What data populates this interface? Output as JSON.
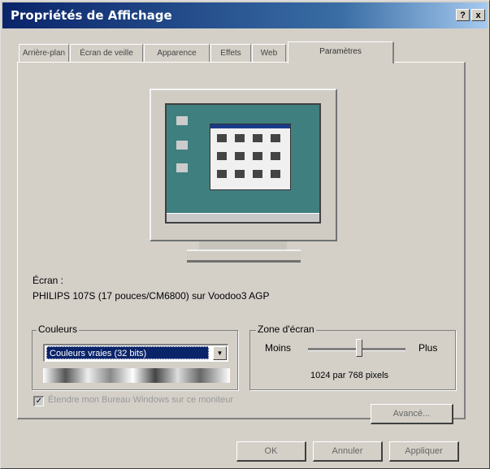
{
  "window": {
    "title": "Propriétés de Affichage",
    "help_btn": "?",
    "close_btn": "x"
  },
  "tabs": [
    {
      "label": "Arrière-plan"
    },
    {
      "label": "Écran de veille"
    },
    {
      "label": "Apparence"
    },
    {
      "label": "Effets"
    },
    {
      "label": "Web"
    },
    {
      "label": "Paramètres"
    }
  ],
  "active_tab": "Paramètres",
  "display": {
    "label": "Écran :",
    "device": "PHILIPS 107S (17 pouces/CM6800) sur Voodoo3 AGP"
  },
  "colors_group": {
    "legend": "Couleurs",
    "selected": "Couleurs vraies (32 bits)",
    "arrow": "▼"
  },
  "screen_area_group": {
    "legend": "Zone d'écran",
    "less_label": "Moins",
    "more_label": "Plus",
    "resolution": "1024 par 768 pixels",
    "slider_level": 0.5
  },
  "extend_checkbox": {
    "label": "Étendre mon Bureau Windows sur ce moniteur",
    "checked": true,
    "check_mark": "✓"
  },
  "buttons": {
    "advanced": "Avancé...",
    "ok": "OK",
    "cancel": "Annuler",
    "apply": "Appliquer"
  }
}
